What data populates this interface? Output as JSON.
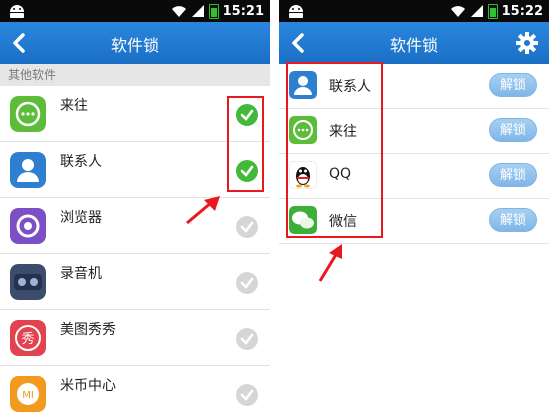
{
  "left": {
    "status_time": "15:21",
    "title": "软件锁",
    "section": "其他软件",
    "apps": [
      {
        "name": "来往",
        "checked": true,
        "icon": "laiwang-icon"
      },
      {
        "name": "联系人",
        "checked": true,
        "icon": "contacts-icon"
      },
      {
        "name": "浏览器",
        "checked": false,
        "icon": "browser-icon"
      },
      {
        "name": "录音机",
        "checked": false,
        "icon": "recorder-icon"
      },
      {
        "name": "美图秀秀",
        "checked": false,
        "icon": "meitu-icon"
      },
      {
        "name": "米币中心",
        "checked": false,
        "icon": "mibi-icon"
      }
    ]
  },
  "right": {
    "status_time": "15:22",
    "title": "软件锁",
    "locked_apps": [
      {
        "name": "联系人",
        "button": "解锁",
        "icon": "contacts-icon"
      },
      {
        "name": "来往",
        "button": "解锁",
        "icon": "laiwang-icon"
      },
      {
        "name": "QQ",
        "button": "解锁",
        "icon": "qq-icon"
      },
      {
        "name": "微信",
        "button": "解锁",
        "icon": "wechat-icon"
      }
    ]
  },
  "icon_texts": {
    "meitu": "秀",
    "mibi": "MI"
  },
  "colors": {
    "titlebar": "#1e78d2",
    "check_on": "#43b83a",
    "check_off": "#d6d6d6",
    "highlight": "#e8181e",
    "unlock_button": "#8cc0ec"
  }
}
